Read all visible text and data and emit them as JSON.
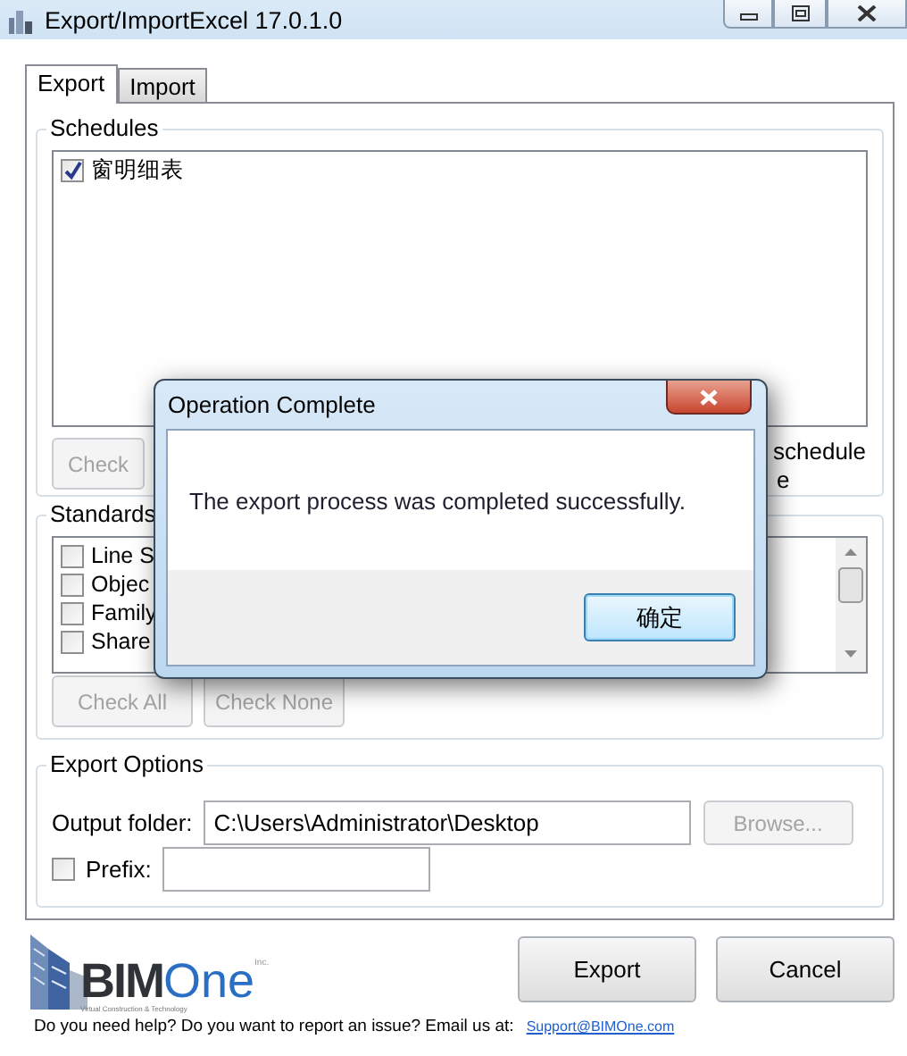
{
  "window": {
    "title": "Export/ImportExcel 17.0.1.0"
  },
  "tabs": [
    {
      "label": "Export",
      "selected": true
    },
    {
      "label": "Import",
      "selected": false
    }
  ],
  "schedules": {
    "title": "Schedules",
    "items": [
      {
        "label": "窗明细表",
        "checked": true
      }
    ],
    "buttons": [
      {
        "label": "Check",
        "disabled": true
      }
    ],
    "note": [
      "schedule",
      "e"
    ]
  },
  "standards": {
    "title": "Standards",
    "items": [
      {
        "label": "Line S",
        "checked": false
      },
      {
        "label": "Objec",
        "checked": false
      },
      {
        "label": "Family",
        "checked": false
      },
      {
        "label": "Share",
        "checked": false
      }
    ],
    "buttons": [
      {
        "label": "Check All",
        "disabled": true
      },
      {
        "label": "Check None",
        "disabled": true
      }
    ]
  },
  "export_options": {
    "title": "Export Options",
    "output_folder": {
      "label": "Output folder:",
      "value": "C:\\Users\\Administrator\\Desktop"
    },
    "browse": {
      "label": "Browse...",
      "disabled": true
    },
    "prefix": {
      "label": "Prefix:",
      "checked": false
    }
  },
  "logo": {
    "name": "BIM",
    "name_2": "One",
    "suffix": "Inc.",
    "tagline": "Virtual Construction & Technology"
  },
  "actions": [
    {
      "label": "Export",
      "disabled": false
    },
    {
      "label": "Cancel",
      "disabled": false
    }
  ],
  "footer": {
    "text": "Do you need help? Do you want to report an issue? Email us at:",
    "link": "Support@BIMOne.com"
  },
  "dialog": {
    "title": "Operation Complete",
    "message": "The export process was completed successfully.",
    "button": "确定"
  }
}
